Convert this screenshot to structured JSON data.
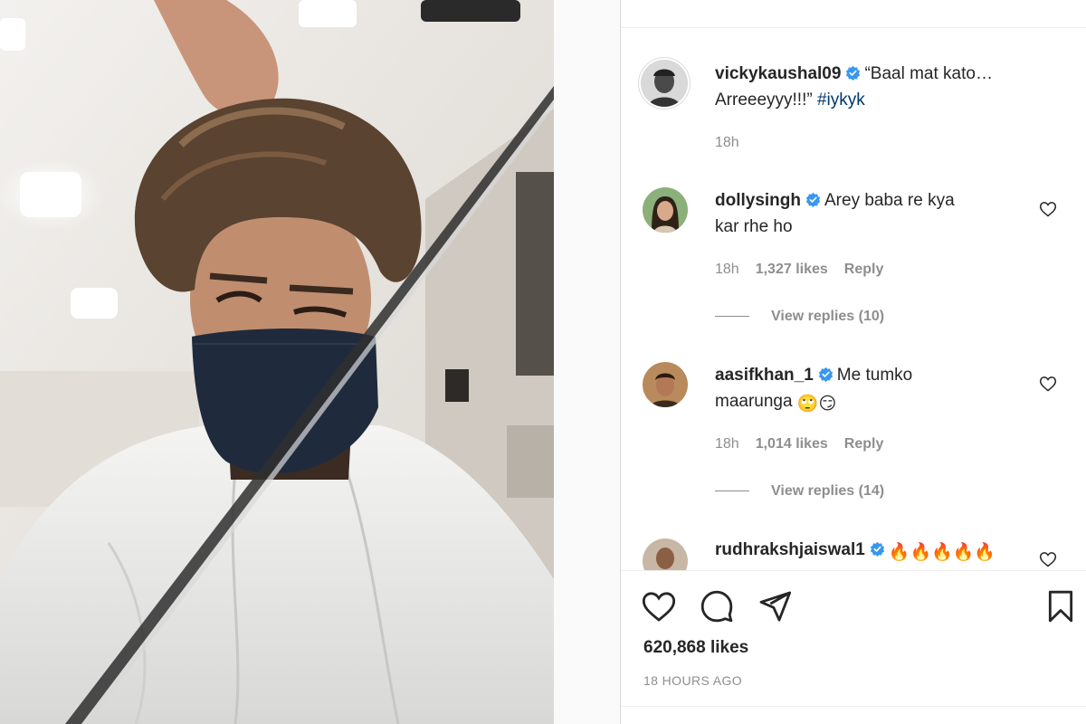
{
  "post": {
    "author": "vickykaushal09",
    "caption_line1": "“Baal mat kato…",
    "caption_line2_text": "Arreeeyyy!!!” ",
    "caption_hashtag": "#iykyk",
    "caption_time": "18h"
  },
  "comments": [
    {
      "username": "dollysingh",
      "text_line1": "Arey baba re kya",
      "text_line2": "kar rhe ho",
      "time": "18h",
      "likes": "1,327 likes",
      "reply_label": "Reply",
      "view_replies": "View replies (10)"
    },
    {
      "username": "aasifkhan_1",
      "text_line1": "Me tumko",
      "text_line2": "maarunga",
      "emojis": "🙄😏",
      "time": "18h",
      "likes": "1,014 likes",
      "reply_label": "Reply",
      "view_replies": "View replies (14)"
    },
    {
      "username": "rudhrakshjaiswal1",
      "emojis": "🔥🔥🔥🔥🔥"
    }
  ],
  "footer": {
    "likes_count": "620,868 likes",
    "time_ago": "18 HOURS AGO"
  },
  "icons": {
    "verified": "verified-badge-icon",
    "like": "heart-icon",
    "comment": "comment-icon",
    "share": "paper-plane-icon",
    "save": "bookmark-icon"
  },
  "colors": {
    "verified_blue": "#3897f0",
    "hashtag": "#00376b",
    "muted": "#8e8e8e",
    "text": "#262626"
  }
}
